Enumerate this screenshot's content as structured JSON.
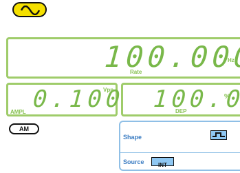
{
  "waveform_icon": "sine-wave-icon",
  "rate": {
    "value": "100.000",
    "unit": "Hz",
    "label": "Rate"
  },
  "ampl": {
    "value": "0.100",
    "unit": "Vpp",
    "label": "AMPL"
  },
  "dep": {
    "value": "100.0",
    "unit": "%",
    "label": "DEP"
  },
  "mode_button": "AM",
  "shape": {
    "label": "Shape",
    "icon": "square-wave-icon"
  },
  "source": {
    "label": "Source",
    "value": "INT"
  },
  "colors": {
    "accent_yellow": "#f5e000",
    "green": "#86c150",
    "blue_border": "#8fbfe6",
    "badge_blue": "#8fc7f2"
  }
}
